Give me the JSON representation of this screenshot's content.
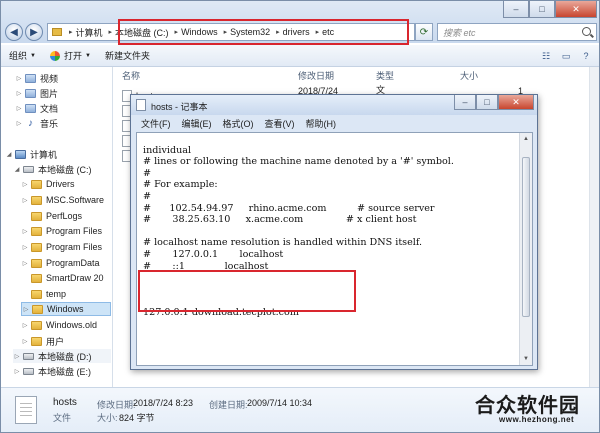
{
  "explorer": {
    "address_crumbs": [
      "计算机",
      "本地磁盘 (C:)",
      "Windows",
      "System32",
      "drivers",
      "etc"
    ],
    "search_placeholder": "搜索 etc",
    "toolbar": {
      "organize": "组织",
      "open": "打开",
      "new_folder": "新建文件夹"
    },
    "columns": {
      "name": "名称",
      "modified": "修改日期",
      "type": "类型",
      "size": "大小"
    },
    "file_row": {
      "name": "hosts",
      "modified": "2018/7/24 8:23",
      "type": "文件",
      "size": "1 KB"
    },
    "nav": {
      "libraries": [
        "视频",
        "图片",
        "文档",
        "音乐"
      ],
      "computer": "计算机",
      "drive_c": "本地磁盘 (C:)",
      "folders": [
        "Drivers",
        "MSC.Software",
        "PerfLogs",
        "Program Files",
        "Program Files",
        "ProgramData",
        "SmartDraw 20",
        "temp",
        "Windows",
        "Windows.old",
        "用户"
      ],
      "drive_d": "本地磁盘 (D:)",
      "drive_e": "本地磁盘 (E:)"
    },
    "details": {
      "name": "hosts",
      "modified_label": "修改日期:",
      "modified_value": "2018/7/24 8:23",
      "created_label": "创建日期:",
      "created_value": "2009/7/14 10:34",
      "type_value": "文件",
      "size_label": "大小:",
      "size_value": "824 字节"
    }
  },
  "notepad": {
    "title": "hosts - 记事本",
    "menu": [
      "文件(F)",
      "编辑(E)",
      "格式(O)",
      "查看(V)",
      "帮助(H)"
    ],
    "lines": [
      "individual",
      "# lines or following the machine name denoted by a '#' symbol.",
      "#",
      "# For example:",
      "#",
      "#      102.54.94.97     rhino.acme.com          # source server",
      "#       38.25.63.10     x.acme.com              # x client host",
      "",
      "# localhost name resolution is handled within DNS itself.",
      "#       127.0.0.1       localhost",
      "#       ::1             localhost",
      "",
      "",
      "",
      "127.0.0.1 download.tecplot.com"
    ]
  },
  "brand": {
    "name": "合众软件园",
    "url": "www.hezhong.net"
  },
  "colors": {
    "highlight": "#d9262e",
    "titlebar": "#c9d9ee",
    "selection": "#cde4f7"
  }
}
